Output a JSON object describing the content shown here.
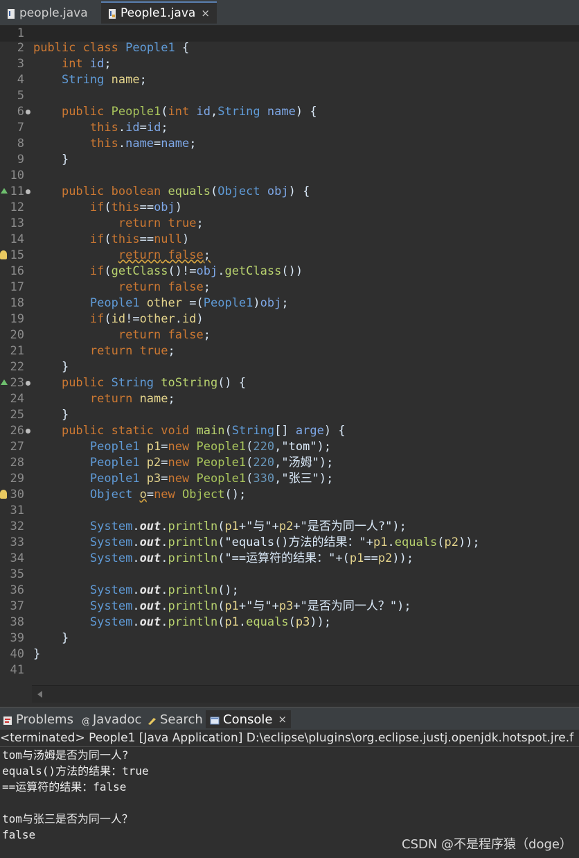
{
  "editor_tabs": [
    {
      "label": "people.java",
      "active": false
    },
    {
      "label": "People1.java",
      "active": true,
      "close": "×"
    }
  ],
  "lines": {
    "l1": "1",
    "l2": "2",
    "l3": "3",
    "l4": "4",
    "l5": "5",
    "l6": "6",
    "l7": "7",
    "l8": "8",
    "l9": "9",
    "l10": "10",
    "l11": "11",
    "l12": "12",
    "l13": "13",
    "l14": "14",
    "l15": "15",
    "l16": "16",
    "l17": "17",
    "l18": "18",
    "l19": "19",
    "l20": "20",
    "l21": "21",
    "l22": "22",
    "l23": "23",
    "l24": "24",
    "l25": "25",
    "l26": "26",
    "l27": "27",
    "l28": "28",
    "l29": "29",
    "l30": "30",
    "l31": "31",
    "l32": "32",
    "l33": "33",
    "l34": "34",
    "l35": "35",
    "l36": "36",
    "l37": "37",
    "l38": "38",
    "l39": "39",
    "l40": "40",
    "l41": "41"
  },
  "tok": {
    "public": "public",
    "class": "class",
    "People1": "People1",
    "brace_open": "{",
    "brace_close": "}",
    "int": "int",
    "id": "id",
    "semicolon": ";",
    "String": "String",
    "name": "name",
    "comma": ",",
    "paren_open": "(",
    "paren_close": ")",
    "this": "this",
    "dot": ".",
    "eq": "=",
    "boolean": "boolean",
    "equals": "equals",
    "Object": "Object",
    "obj": "obj",
    "if": "if",
    "eqeq": "==",
    "return": "return",
    "true": "true",
    "false": "false",
    "null": "null",
    "getClass": "getClass",
    "neq": "!=",
    "other": "other",
    "toString": "toString",
    "static": "static",
    "void": "void",
    "main": "main",
    "brackets": "[]",
    "arge": "arge",
    "p1": "p1",
    "p2": "p2",
    "p3": "p3",
    "new": "new",
    "o": "o",
    "n220": "220",
    "n330": "330",
    "s_tom": "\"tom\"",
    "s_tangmu": "\"汤姆\"",
    "s_zhangsan": "\"张三\"",
    "System": "System",
    "out": "out",
    "println": "println",
    "plus": "+",
    "s_yu": "\"与\"",
    "s_same1": "\"是否为同一人?\"",
    "s_equals_res": "\"equals()方法的结果：\"",
    "s_op_res": "\"==运算符的结果：\"",
    "s_same2": "\"是否为同一人？\""
  },
  "view_tabs": [
    {
      "label": "Problems"
    },
    {
      "label": "Javadoc"
    },
    {
      "label": "Search"
    },
    {
      "label": "Console",
      "active": true,
      "close": "×"
    }
  ],
  "console": {
    "description": "<terminated> People1 [Java Application] D:\\eclipse\\plugins\\org.eclipse.justj.openjdk.hotspot.jre.f",
    "output": [
      "tom与汤姆是否为同一人?",
      "equals()方法的结果：true",
      "==运算符的结果：false",
      "",
      "tom与张三是否为同一人？",
      "false"
    ]
  },
  "watermark": "CSDN @不是程序猿（doge）",
  "colors": {
    "background": "#2f2f2f",
    "keyword": "#cc7832",
    "type": "#5f9ad6",
    "string": "#e4d48c",
    "method": "#b8d26e"
  }
}
